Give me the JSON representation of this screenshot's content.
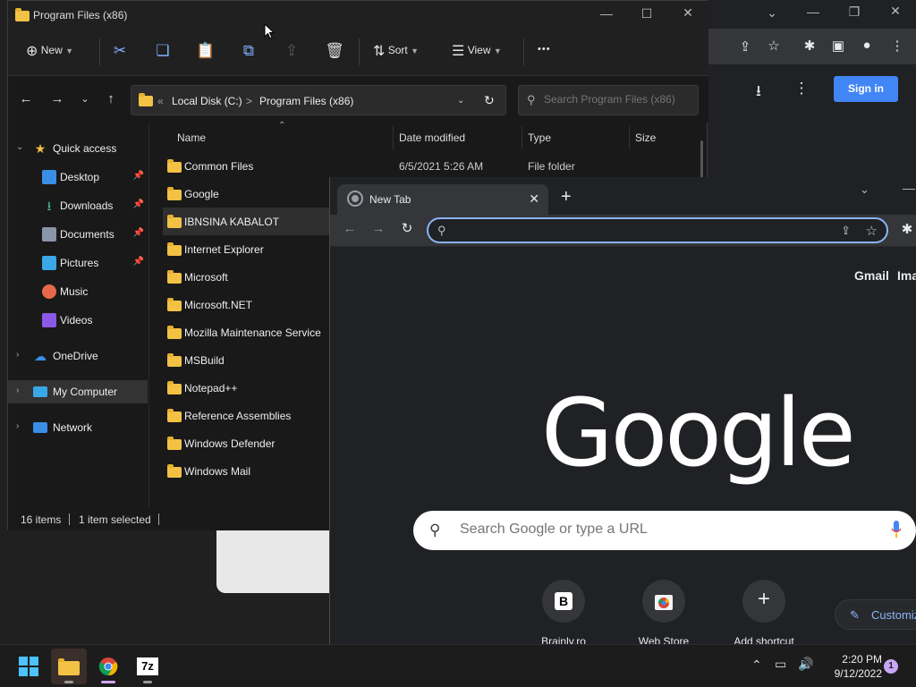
{
  "explorer": {
    "title": "Program Files (x86)",
    "cmdbar": {
      "new_label": "New",
      "sort_label": "Sort",
      "view_label": "View",
      "more_label": "•••"
    },
    "address": {
      "root": "Local Disk (C:)",
      "current": "Program Files (x86)",
      "separator": ">",
      "overflow": "«"
    },
    "search_placeholder": "Search Program Files (x86)",
    "nav": {
      "quick_access": "Quick access",
      "desktop": "Desktop",
      "downloads": "Downloads",
      "documents": "Documents",
      "pictures": "Pictures",
      "music": "Music",
      "videos": "Videos",
      "onedrive": "OneDrive",
      "my_computer": "My Computer",
      "network": "Network"
    },
    "columns": {
      "name": "Name",
      "date": "Date modified",
      "type": "Type",
      "size": "Size"
    },
    "rows": [
      {
        "name": "Common Files",
        "date": "6/5/2021 5:26 AM",
        "type": "File folder"
      },
      {
        "name": "Google"
      },
      {
        "name": "IBNSINA KABALOT"
      },
      {
        "name": "Internet Explorer"
      },
      {
        "name": "Microsoft"
      },
      {
        "name": "Microsoft.NET"
      },
      {
        "name": "Mozilla Maintenance Service"
      },
      {
        "name": "MSBuild"
      },
      {
        "name": "Notepad++"
      },
      {
        "name": "Reference Assemblies"
      },
      {
        "name": "Windows Defender"
      },
      {
        "name": "Windows Mail"
      }
    ],
    "status": {
      "count": "16 items",
      "selected": "1 item selected"
    }
  },
  "bg_chrome": {
    "signin_label": "Sign in"
  },
  "chrome": {
    "tab_label": "New Tab",
    "omnibox_value": "",
    "links": {
      "gmail": "Gmail",
      "images": "Ima"
    },
    "logo": "Google",
    "search_placeholder": "Search Google or type a URL",
    "shortcuts": [
      {
        "label": "Brainly.ro",
        "icon": "B"
      },
      {
        "label": "Web Store",
        "icon": ""
      },
      {
        "label": "Add shortcut",
        "icon": "+"
      }
    ],
    "customize_label": "Customiz"
  },
  "taskbar": {
    "time": "2:20 PM",
    "date": "9/12/2022",
    "notification_count": "1",
    "sevenzip_label": "7z"
  },
  "colors": {
    "accent_blue": "#4285f4",
    "omnibox_border": "#8ab4f8",
    "folder": "#f3c245"
  }
}
